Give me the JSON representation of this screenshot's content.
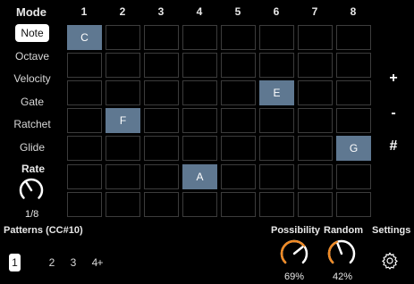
{
  "header": {
    "mode_label": "Mode",
    "columns": [
      "1",
      "2",
      "3",
      "4",
      "5",
      "6",
      "7",
      "8"
    ]
  },
  "modes": [
    {
      "label": "Note",
      "active": true
    },
    {
      "label": "Octave",
      "active": false
    },
    {
      "label": "Velocity",
      "active": false
    },
    {
      "label": "Gate",
      "active": false
    },
    {
      "label": "Ratchet",
      "active": false
    },
    {
      "label": "Glide",
      "active": false
    }
  ],
  "grid": [
    [
      "C",
      "",
      "",
      "",
      "",
      "",
      "",
      ""
    ],
    [
      "",
      "",
      "",
      "",
      "",
      "",
      "",
      ""
    ],
    [
      "",
      "",
      "",
      "",
      "",
      "E",
      "",
      ""
    ],
    [
      "",
      "F",
      "",
      "",
      "",
      "",
      "",
      ""
    ],
    [
      "",
      "",
      "",
      "",
      "",
      "",
      "",
      "G"
    ],
    [
      "",
      "",
      "",
      "A",
      "",
      "",
      "",
      ""
    ],
    [
      "",
      "",
      "",
      "",
      "",
      "",
      "",
      ""
    ]
  ],
  "side_buttons": {
    "plus": "+",
    "minus": "-",
    "hash": "#"
  },
  "rate": {
    "label": "Rate",
    "value": "1/8"
  },
  "patterns": {
    "title": "Patterns (CC#10)",
    "items": [
      "1",
      "2",
      "3",
      "4"
    ],
    "add": "+",
    "active_index": 0
  },
  "possibility": {
    "label": "Possibility",
    "value": "69%",
    "level": 0.69
  },
  "random": {
    "label": "Random",
    "value": "42%",
    "level": 0.42
  },
  "settings": {
    "label": "Settings",
    "icon": "gear-icon"
  },
  "colors": {
    "accent": "#f08a24",
    "step_on": "#5f7891",
    "grid_line": "#3c3c3c"
  }
}
